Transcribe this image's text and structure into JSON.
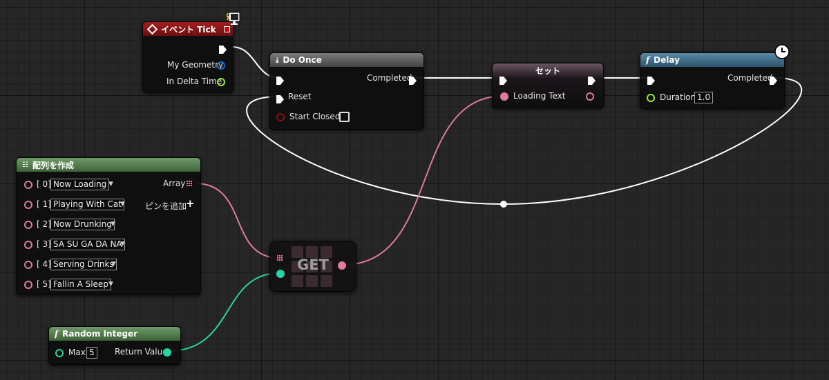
{
  "colors": {
    "exec_wire": "#ffffff",
    "string_pin": "#e07aa0",
    "int_pin": "#27d4a4",
    "float_pin": "#9ae83a",
    "struct_pin": "#1a6dd6",
    "event_header": "#8b1515",
    "function_header": "#3c6e86",
    "macro_header": "#555555",
    "make_array_header": "#4f7a4a"
  },
  "event_tick": {
    "title": "イベント Tick",
    "icon": "event-diamond-icon",
    "pins": {
      "geometry": "My Geometry",
      "delta": "In Delta Time"
    }
  },
  "do_once": {
    "title": "Do Once",
    "icon": "macro-icon",
    "pins": {
      "completed": "Completed",
      "reset": "Reset",
      "start_closed": "Start Closed"
    }
  },
  "set_node": {
    "title": "セット",
    "pins": {
      "loading_text": "Loading Text"
    }
  },
  "delay": {
    "title": "Delay",
    "icon": "function-f-icon",
    "pins": {
      "completed": "Completed",
      "duration": "Duration"
    },
    "duration_value": "1.0"
  },
  "make_array": {
    "title": "配列を作成",
    "icon": "array-grid-icon",
    "output_label": "Array",
    "add_pin_label": "ピンを追加",
    "items": [
      {
        "index": "[ 0]",
        "value": "Now Loading"
      },
      {
        "index": "[ 1]",
        "value": "Playing With Cat"
      },
      {
        "index": "[ 2]",
        "value": "Now Drunking"
      },
      {
        "index": "[ 3]",
        "value": "SA SU GA DA NA"
      },
      {
        "index": "[ 4]",
        "value": "Serving Drinks"
      },
      {
        "index": "[ 5]",
        "value": "Fallin A Sleep"
      }
    ]
  },
  "get_node": {
    "title": "GET"
  },
  "random_integer": {
    "title": "Random Integer",
    "icon": "function-f-icon",
    "pins": {
      "max": "Max",
      "return_value": "Return Value"
    },
    "max_value": "5"
  }
}
